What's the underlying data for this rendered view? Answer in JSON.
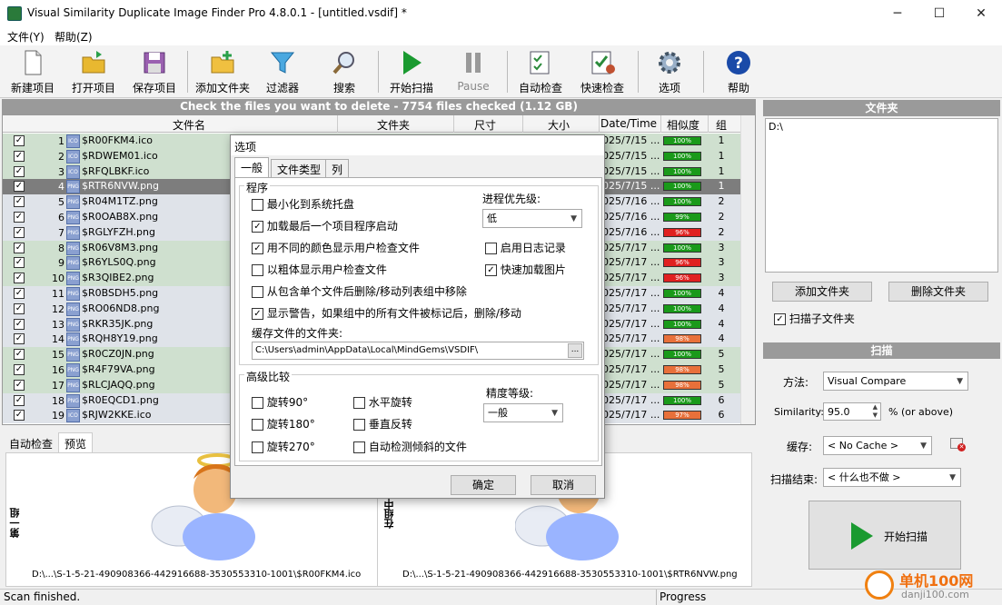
{
  "window": {
    "title": "Visual Similarity Duplicate Image Finder Pro 4.8.0.1 - [untitled.vsdif] *",
    "min": "─",
    "max": "☐",
    "close": "✕"
  },
  "menu": [
    {
      "label": "文件(Y)"
    },
    {
      "label": "帮助(Z)"
    }
  ],
  "toolbar": [
    {
      "label": "新建项目",
      "icon": "new-document-icon"
    },
    {
      "label": "打开项目",
      "icon": "open-folder-icon"
    },
    {
      "label": "保存项目",
      "icon": "save-disk-icon"
    },
    {
      "label": "添加文件夹",
      "icon": "add-folder-icon"
    },
    {
      "label": "过滤器",
      "icon": "filter-funnel-icon"
    },
    {
      "label": "搜索",
      "icon": "magnifier-icon"
    },
    {
      "label": "开始扫描",
      "icon": "play-icon"
    },
    {
      "label": "Pause",
      "icon": "pause-icon"
    },
    {
      "label": "自动检查",
      "icon": "auto-check-icon"
    },
    {
      "label": "快速检查",
      "icon": "quick-check-icon"
    },
    {
      "label": "选项",
      "icon": "gear-icon"
    },
    {
      "label": "帮助",
      "icon": "help-icon"
    }
  ],
  "banner": "Check the files you want to delete - 7754 files checked (1.12 GB)",
  "columns": [
    "文件名",
    "文件夹",
    "尺寸",
    "大小",
    "Date/Time",
    "相似度",
    "组"
  ],
  "rows": [
    {
      "n": "1",
      "name": "$R00FKM4.ico",
      "date": "025/7/15 ...",
      "sim": "100%",
      "simc": "#1a9a1a",
      "g": "1",
      "t": "a",
      "ext": "ICO"
    },
    {
      "n": "2",
      "name": "$RDWEM01.ico",
      "date": "025/7/15 ...",
      "sim": "100%",
      "simc": "#1a9a1a",
      "g": "1",
      "t": "a",
      "ext": "ICO"
    },
    {
      "n": "3",
      "name": "$RFQLBKF.ico",
      "date": "025/7/15 ...",
      "sim": "100%",
      "simc": "#1a9a1a",
      "g": "1",
      "t": "a",
      "ext": "ICO"
    },
    {
      "n": "4",
      "name": "$RTR6NVW.png",
      "date": "025/7/15 ...",
      "sim": "100%",
      "simc": "#1a9a1a",
      "g": "1",
      "t": "sel",
      "ext": "PNG"
    },
    {
      "n": "5",
      "name": "$R04M1TZ.png",
      "date": "025/7/16 ...",
      "sim": "100%",
      "simc": "#1a9a1a",
      "g": "2",
      "t": "b",
      "ext": "PNG"
    },
    {
      "n": "6",
      "name": "$R0OAB8X.png",
      "date": "025/7/16 ...",
      "sim": "99%",
      "simc": "#1a9a1a",
      "g": "2",
      "t": "b",
      "ext": "PNG"
    },
    {
      "n": "7",
      "name": "$RGLYFZH.png",
      "date": "025/7/16 ...",
      "sim": "96%",
      "simc": "#e02020",
      "g": "2",
      "t": "b",
      "ext": "PNG"
    },
    {
      "n": "8",
      "name": "$R06V8M3.png",
      "date": "025/7/17 ...",
      "sim": "100%",
      "simc": "#1a9a1a",
      "g": "3",
      "t": "a",
      "ext": "PNG"
    },
    {
      "n": "9",
      "name": "$R6YLS0Q.png",
      "date": "025/7/17 ...",
      "sim": "96%",
      "simc": "#e02020",
      "g": "3",
      "t": "a",
      "ext": "PNG"
    },
    {
      "n": "10",
      "name": "$R3QIBE2.png",
      "date": "025/7/17 ...",
      "sim": "96%",
      "simc": "#e02020",
      "g": "3",
      "t": "a",
      "ext": "PNG"
    },
    {
      "n": "11",
      "name": "$R0BSDH5.png",
      "date": "025/7/17 ...",
      "sim": "100%",
      "simc": "#1a9a1a",
      "g": "4",
      "t": "b",
      "ext": "PNG"
    },
    {
      "n": "12",
      "name": "$RO06ND8.png",
      "date": "025/7/17 ...",
      "sim": "100%",
      "simc": "#1a9a1a",
      "g": "4",
      "t": "b",
      "ext": "PNG"
    },
    {
      "n": "13",
      "name": "$RKR35JK.png",
      "date": "025/7/17 ...",
      "sim": "100%",
      "simc": "#1a9a1a",
      "g": "4",
      "t": "b",
      "ext": "PNG"
    },
    {
      "n": "14",
      "name": "$RQH8Y19.png",
      "date": "025/7/17 ...",
      "sim": "98%",
      "simc": "#e8703a",
      "g": "4",
      "t": "b",
      "ext": "PNG"
    },
    {
      "n": "15",
      "name": "$R0CZ0JN.png",
      "date": "025/7/17 ...",
      "sim": "100%",
      "simc": "#1a9a1a",
      "g": "5",
      "t": "a",
      "ext": "PNG"
    },
    {
      "n": "16",
      "name": "$R4F79VA.png",
      "date": "025/7/17 ...",
      "sim": "98%",
      "simc": "#e8703a",
      "g": "5",
      "t": "a",
      "ext": "PNG"
    },
    {
      "n": "17",
      "name": "$RLCJAQQ.png",
      "date": "025/7/17 ...",
      "sim": "98%",
      "simc": "#e8703a",
      "g": "5",
      "t": "a",
      "ext": "PNG"
    },
    {
      "n": "18",
      "name": "$R0EQCD1.png",
      "date": "025/7/17 ...",
      "sim": "100%",
      "simc": "#1a9a1a",
      "g": "6",
      "t": "b",
      "ext": "PNG"
    },
    {
      "n": "19",
      "name": "$RJW2KKE.ico",
      "date": "025/7/17 ...",
      "sim": "97%",
      "simc": "#e8703a",
      "g": "6",
      "t": "b",
      "ext": "ICO"
    }
  ],
  "folders": {
    "title": "文件夹",
    "items": [
      "D:\\"
    ],
    "add": "添加文件夹",
    "remove": "删除文件夹",
    "subfolders": "扫描子文件夹"
  },
  "scan": {
    "title": "扫描",
    "method_label": "方法:",
    "method": "Visual Compare",
    "sim_label": "Similarity:",
    "sim_value": "95.0",
    "sim_unit": "% (or above)",
    "cache_label": "缓存:",
    "cache": "< No Cache >",
    "end_label": "扫描结束:",
    "end": "< 什么也不做 >",
    "start": "开始扫描"
  },
  "preview": {
    "tabs": [
      "自动检查",
      "预览"
    ],
    "left_label": "第一组",
    "right_label": "在组中",
    "left_path": "D:\\...\\S-1-5-21-490908366-442916688-3530553310-1001\\$R00FKM4.ico",
    "right_path": "D:\\...\\S-1-5-21-490908366-442916688-3530553310-1001\\$RTR6NVW.png"
  },
  "status": {
    "left": "Scan finished.",
    "right": "Progress"
  },
  "watermark": {
    "name": "单机100网",
    "url": "danji100.com"
  },
  "dialog": {
    "title": "选项",
    "tabs": [
      "一般",
      "文件类型",
      "列"
    ],
    "program_group": "程序",
    "opts_left": [
      {
        "label": "最小化到系统托盘",
        "checked": ""
      },
      {
        "label": "加载最后一个项目程序启动",
        "checked": "✓"
      },
      {
        "label": "用不同的颜色显示用户检查文件",
        "checked": "✓"
      },
      {
        "label": "以粗体显示用户检查文件",
        "checked": ""
      },
      {
        "label": "从包含单个文件后删除/移动列表组中移除",
        "checked": ""
      },
      {
        "label": "显示警告，如果组中的所有文件被标记后，删除/移动",
        "checked": "✓"
      }
    ],
    "priority_label": "进程优先级:",
    "priority": "低",
    "log_label": "启用日志记录",
    "log_checked": "",
    "fast_label": "快速加载图片",
    "fast_checked": "✓",
    "cache_label": "缓存文件的文件夹:",
    "cache_path": "C:\\Users\\admin\\AppData\\Local\\MindGems\\VSDIF\\",
    "browse": "...",
    "adv_group": "高级比较",
    "rot90": "旋转90°",
    "rot180": "旋转180°",
    "rot270": "旋转270°",
    "hflip": "水平旋转",
    "vflip": "垂直反转",
    "tilt": "自动检测倾斜的文件",
    "precision_label": "精度等级:",
    "precision": "一般",
    "ok": "确定",
    "cancel": "取消"
  }
}
